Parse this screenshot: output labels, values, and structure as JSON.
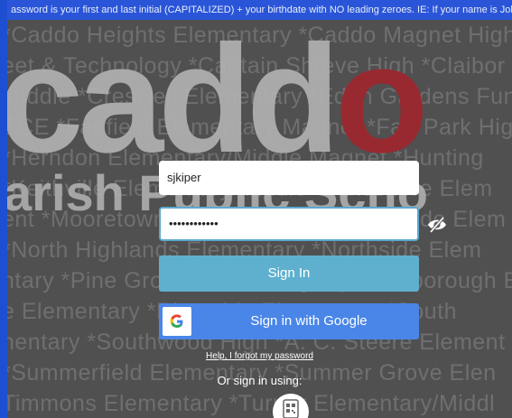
{
  "banner": {
    "text": "assword is your first and last initial (CAPITALIZED) + your birthdate with NO leading zeroes. IE: If your name is John Smith and you were b"
  },
  "background": {
    "lines": [
      "*Caddo Heights Elementary *Caddo Magnet High",
      "eet & Technology *Captain Shreve High *Claibor",
      "Middle *Creswell Elementary *Eden Gardens Fun",
      "ECE *Fairfield Elementary Magnet *Fair Park High",
      "*Herndon Elementary/Middle Magnet *Hunting",
      "*Keithville Elementary/Middle *Lakeshore Elem",
      "ent *Mooretown Elementary *Morning Side Elem *Mo",
      "*North Highlands Elementary *Northside Elem",
      "ntary *Pine Grove Elementary *Queensborough El",
      "e Elementary *Riverside Elementary *South",
      "nentary *Southwood High *A. C. Steere Element",
      "*Summerfield Elementary *Summer Grove Elen",
      "Timmons Elementary *Turner Elementary/Middl"
    ],
    "logo_word": "cadd",
    "logo_red": "o",
    "parish_word": "arish Public Scho"
  },
  "login": {
    "username_value": "sjkiper",
    "password_value": "••••••••••••",
    "signin_label": "Sign In",
    "google_label": "Sign in with Google",
    "forgot_label": "Help, I forgot my password",
    "or_label": "Or sign in using:"
  },
  "colors": {
    "accent": "#5fb0cf",
    "google_blue": "#4a86e8",
    "banner_blue": "#2a55d8",
    "red": "#c9202a"
  }
}
